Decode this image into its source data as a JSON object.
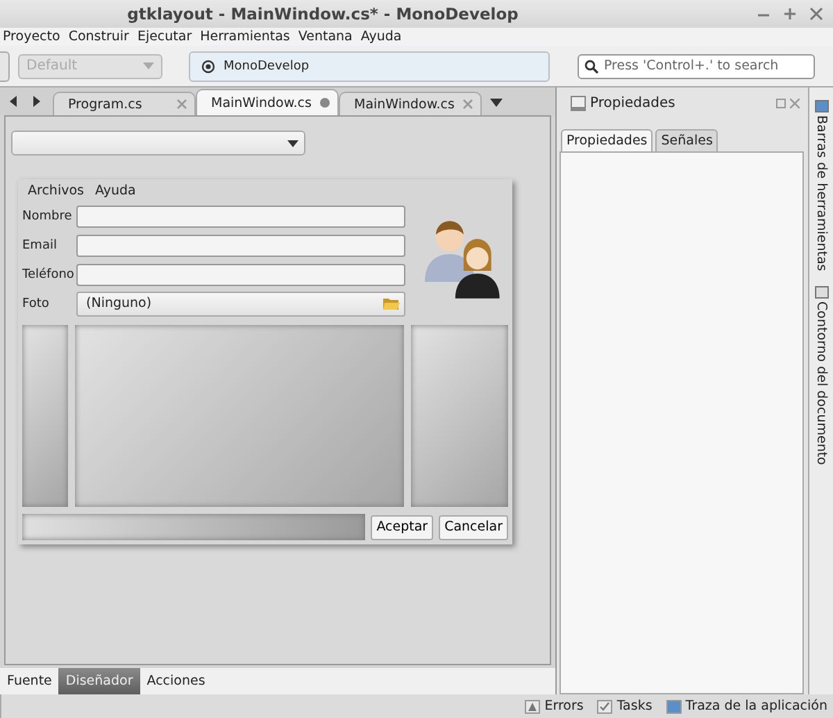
{
  "window": {
    "title": "gtklayout - MainWindow.cs* - MonoDevelop"
  },
  "menu": [
    "Proyecto",
    "Construir",
    "Ejecutar",
    "Herramientas",
    "Ventana",
    "Ayuda"
  ],
  "toolbar": {
    "config": {
      "value": "Default",
      "disabled": true
    },
    "status": "MonoDevelop",
    "search": {
      "placeholder": "Press 'Control+.' to search"
    }
  },
  "doc_tabs": [
    {
      "label": "Program.cs",
      "selected": false,
      "modified": false
    },
    {
      "label": "MainWindow.cs",
      "selected": true,
      "modified": true
    },
    {
      "label": "MainWindow.cs",
      "selected": false,
      "modified": false
    }
  ],
  "designer": {
    "menu": [
      "Archivos",
      "Ayuda"
    ],
    "fields": [
      {
        "label": "Nombre",
        "kind": "text"
      },
      {
        "label": "Email",
        "kind": "text"
      },
      {
        "label": "Teléfono",
        "kind": "text"
      },
      {
        "label": "Foto",
        "kind": "file",
        "value": "(Ninguno)"
      }
    ],
    "buttons": [
      "Aceptar",
      "Cancelar"
    ]
  },
  "view_tabs": [
    {
      "label": "Fuente",
      "selected": false
    },
    {
      "label": "Diseñador",
      "selected": true
    },
    {
      "label": "Acciones",
      "selected": false
    }
  ],
  "properties": {
    "title": "Propiedades",
    "tabs": [
      {
        "label": "Propiedades",
        "selected": true
      },
      {
        "label": "Señales",
        "selected": false
      }
    ]
  },
  "side_pads": [
    "Barras de herramientas",
    "Contorno del documento"
  ],
  "status_pads": [
    {
      "label": "Errors",
      "kind": "errors"
    },
    {
      "label": "Tasks",
      "kind": "tasks"
    },
    {
      "label": "Traza de la aplicación",
      "kind": "log"
    }
  ]
}
